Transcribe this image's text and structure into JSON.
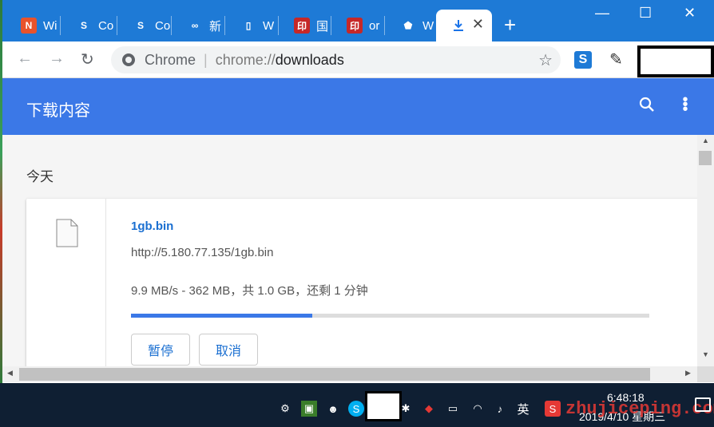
{
  "tabs": [
    {
      "label": "Wi",
      "favicon": "N",
      "color": "#e8532c"
    },
    {
      "label": "Co",
      "favicon": "S",
      "color": "#1e7ad6"
    },
    {
      "label": "Co",
      "favicon": "S",
      "color": "#1e7ad6"
    },
    {
      "label": "新",
      "favicon": "∞",
      "color": "#1e7ad6"
    },
    {
      "label": "W",
      "favicon": "▯",
      "color": "#1e7ad6"
    },
    {
      "label": "国",
      "favicon": "印",
      "color": "#c62828"
    },
    {
      "label": "or",
      "favicon": "印",
      "color": "#c62828"
    },
    {
      "label": "W",
      "favicon": "⬟",
      "color": "#1e7ad6"
    }
  ],
  "active_tab": {
    "icon": "download-icon"
  },
  "omnibox": {
    "chip": "Chrome",
    "scheme": "chrome://",
    "host": "downloads"
  },
  "downloads": {
    "title": "下载内容",
    "section": "今天",
    "item": {
      "filename": "1gb.bin",
      "url": "http://5.180.77.135/1gb.bin",
      "status": "9.9 MB/s - 362 MB，共 1.0 GB，还剩 1 分钟",
      "progress_fraction": 0.35,
      "pause_label": "暂停",
      "cancel_label": "取消"
    }
  },
  "taskbar": {
    "time": "6:48:18",
    "date": "2019/4/10 星期三",
    "ime": "英",
    "watermark": "zhujiceping.com"
  }
}
